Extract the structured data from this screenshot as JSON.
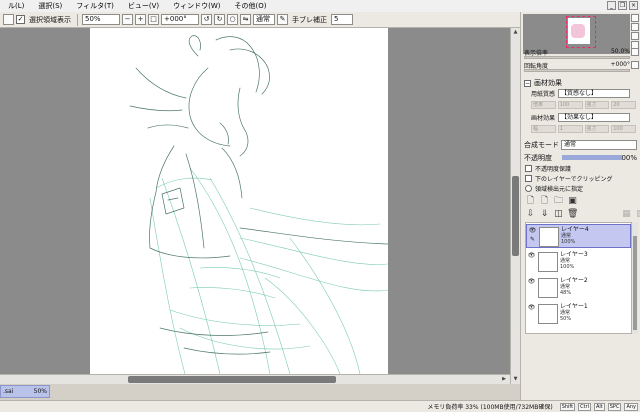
{
  "menu": [
    "ル(L)",
    "選択(S)",
    "フィルタ(T)",
    "ビュー(V)",
    "ウィンドウ(W)",
    "その他(O)"
  ],
  "toolbar": {
    "show_selection_label": "選択領域表示",
    "zoom_value": "50%",
    "rotation_value": "+000°",
    "blend_label": "通常",
    "stabilizer_label": "手ブレ補正",
    "stabilizer_value": "5"
  },
  "navigator": {
    "zoom_label": "表示倍率",
    "zoom_value": "50.0%",
    "angle_label": "回転角度",
    "angle_value": "+000°"
  },
  "paper_texture": {
    "header": "画材効果",
    "texture_label": "用紙質感",
    "texture_value": "【質感なし】",
    "texture_sub": [
      "倍率",
      "100",
      "強さ",
      "20"
    ],
    "effect_label": "画材効果",
    "effect_value": "【効果なし】",
    "effect_sub": [
      "幅",
      "1",
      "強さ",
      "100"
    ]
  },
  "layer_props": {
    "blend_label": "合成モード",
    "blend_value": "通常",
    "opacity_label": "不透明度",
    "opacity_value": "100%",
    "options": [
      "不透明度保護",
      "下のレイヤーでクリッピング",
      "領域検出元に指定"
    ]
  },
  "layers": [
    {
      "name": "レイヤー4",
      "mode": "通常",
      "opacity": "100%",
      "selected": true
    },
    {
      "name": "レイヤー3",
      "mode": "通常",
      "opacity": "100%",
      "selected": false
    },
    {
      "name": "レイヤー2",
      "mode": "通常",
      "opacity": "48%",
      "selected": false
    },
    {
      "name": "レイヤー1",
      "mode": "通常",
      "opacity": "50%",
      "selected": false
    }
  ],
  "document_tab": {
    "name": ".sai",
    "zoom": "50%"
  },
  "status": {
    "memory": "メモリ負荷率 33% (100MB使用/732MB確保)",
    "keys": [
      "Shift",
      "Ctrl",
      "Alt",
      "SPC",
      "Any"
    ]
  },
  "colors": {
    "sketch_line": "#4fb89a",
    "sketch_dark": "#2f5f55",
    "layer_selected": "#c4c7ef",
    "nav_frame": "#e52b6d"
  }
}
